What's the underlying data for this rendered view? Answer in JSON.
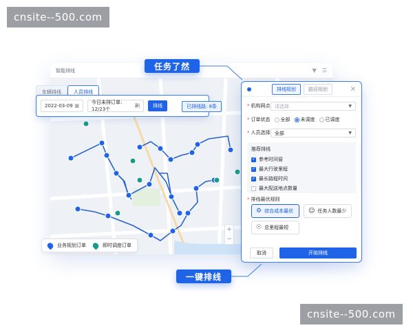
{
  "watermark": {
    "top": "cnsite--500.com",
    "bottom": "cnsite--500.com"
  },
  "app": {
    "title": "智能排线"
  },
  "callouts": {
    "top": "任务了然",
    "bottom": "一键排线"
  },
  "tabs": [
    {
      "label": "车辆排线"
    },
    {
      "label": "人员排线"
    }
  ],
  "filter": {
    "date": "2022-03-09",
    "unscheduled_label": "今日未排订单: 12/23个",
    "refresh_suffix": "刷",
    "plan_button": "排线",
    "scheduled_pill": "已排线路: 8条"
  },
  "map": {
    "zoom_in": "+",
    "zoom_out": "−"
  },
  "legend": {
    "business": "业务规划订单",
    "instant": "即时调度订单"
  },
  "colors": {
    "accent": "#1f63e6",
    "business_marker": "#1f63e6",
    "instant_marker": "#1a9a88"
  },
  "side_panel": {
    "tabs": [
      {
        "label": "排线规划"
      },
      {
        "label": "路径规划"
      }
    ],
    "close": "×",
    "org_label": "机构网点",
    "org_placeholder": "请选择",
    "status_label": "订单状态",
    "status_options": [
      {
        "label": "全部",
        "checked": false
      },
      {
        "label": "未调度",
        "checked": true
      },
      {
        "label": "已调度",
        "checked": false
      }
    ],
    "staff_label": "人员选择",
    "staff_value": "全部",
    "recommend_title": "推荐排线",
    "recommend_items": [
      {
        "label": "参考时间窗",
        "checked": true
      },
      {
        "label": "最大行驶里程",
        "checked": true
      },
      {
        "label": "最长路程时间",
        "checked": true
      },
      {
        "label": "最大配送地点数量",
        "checked": false
      }
    ],
    "optimize_title": "排线最优规则",
    "optimize_options": [
      {
        "label": "综合成本最优",
        "icon": "cost-icon",
        "selected": true
      },
      {
        "label": "任务人数最少",
        "icon": "person-icon",
        "selected": false
      },
      {
        "label": "总里程最短",
        "icon": "distance-icon",
        "selected": false
      }
    ],
    "cancel": "取消",
    "start": "开始排线"
  }
}
